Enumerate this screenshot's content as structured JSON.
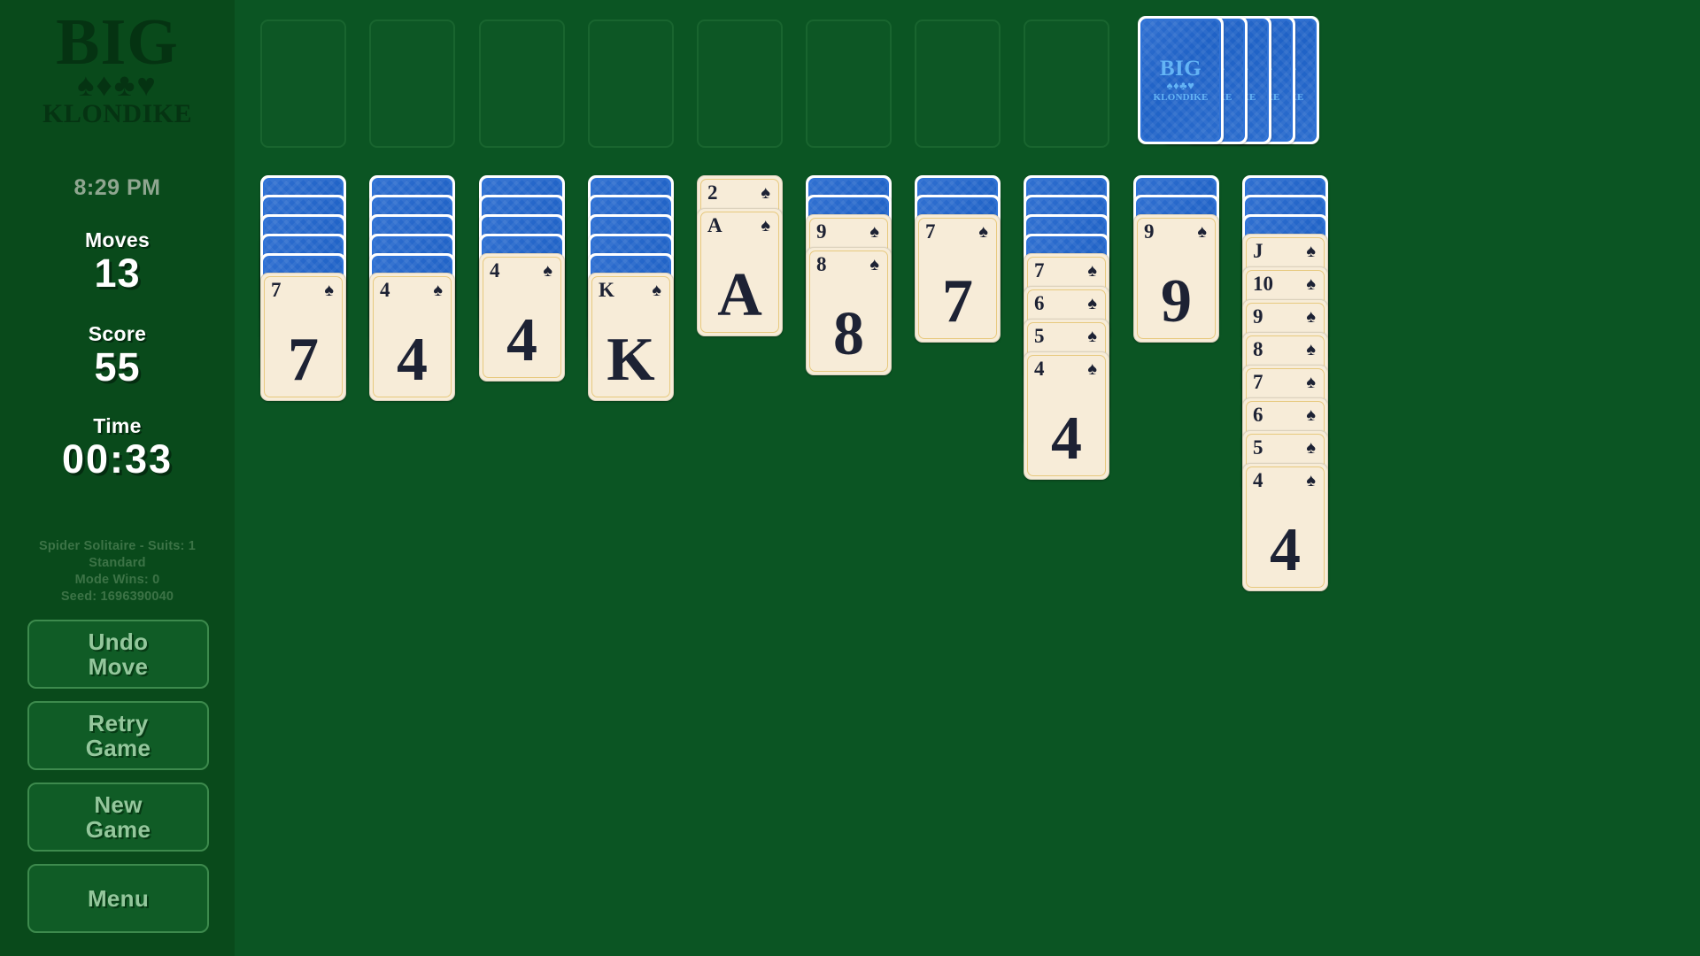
{
  "app": {
    "logo_top": "BIG",
    "logo_suits": "♠♦♣♥",
    "logo_bottom": "KLONDIKE",
    "clock": "8:29 PM",
    "table_color": "#0b5523",
    "sidebar_color": "#094a1b",
    "card_back_color": "#2464c8",
    "card_face_color": "#f7ecd8"
  },
  "stats": {
    "moves_label": "Moves",
    "moves_value": "13",
    "score_label": "Score",
    "score_value": "55",
    "time_label": "Time",
    "time_value": "00:33"
  },
  "game_info": {
    "line1": "Spider Solitaire - Suits: 1",
    "line2": "Standard",
    "line3": "Mode Wins: 0",
    "line4": "Seed: 1696390040"
  },
  "buttons": [
    {
      "name": "undo-move-button",
      "label": "Undo\nMove"
    },
    {
      "name": "retry-game-button",
      "label": "Retry\nGame"
    },
    {
      "name": "new-game-button",
      "label": "New\nGame"
    },
    {
      "name": "menu-button",
      "label": "Menu"
    }
  ],
  "board": {
    "foundation_count": 8,
    "foundations": [
      {
        "index": 1,
        "empty": true
      },
      {
        "index": 2,
        "empty": true
      },
      {
        "index": 3,
        "empty": true
      },
      {
        "index": 4,
        "empty": true
      },
      {
        "index": 5,
        "empty": true
      },
      {
        "index": 6,
        "empty": true
      },
      {
        "index": 7,
        "empty": true
      },
      {
        "index": 8,
        "empty": true
      }
    ],
    "stock": {
      "deal_piles_remaining": 5,
      "label": "stock-pile"
    },
    "card_back_text": {
      "top": "BIG",
      "suits": "♠♦♣♥",
      "bottom": "KLONDIKE"
    },
    "tableau": [
      {
        "column": 1,
        "facedown": 5,
        "faceup": [
          {
            "rank": "7",
            "suit": "♠"
          }
        ]
      },
      {
        "column": 2,
        "facedown": 5,
        "faceup": [
          {
            "rank": "4",
            "suit": "♠"
          }
        ]
      },
      {
        "column": 3,
        "facedown": 4,
        "faceup": [
          {
            "rank": "4",
            "suit": "♠"
          }
        ]
      },
      {
        "column": 4,
        "facedown": 5,
        "faceup": [
          {
            "rank": "K",
            "suit": "♠"
          }
        ]
      },
      {
        "column": 5,
        "facedown": 0,
        "faceup": [
          {
            "rank": "2",
            "suit": "♠"
          },
          {
            "rank": "A",
            "suit": "♠"
          }
        ]
      },
      {
        "column": 6,
        "facedown": 2,
        "faceup": [
          {
            "rank": "9",
            "suit": "♠"
          },
          {
            "rank": "8",
            "suit": "♠"
          }
        ]
      },
      {
        "column": 7,
        "facedown": 2,
        "faceup": [
          {
            "rank": "7",
            "suit": "♠"
          }
        ]
      },
      {
        "column": 8,
        "facedown": 4,
        "faceup": [
          {
            "rank": "7",
            "suit": "♠"
          },
          {
            "rank": "6",
            "suit": "♠"
          },
          {
            "rank": "5",
            "suit": "♠"
          },
          {
            "rank": "4",
            "suit": "♠"
          }
        ]
      },
      {
        "column": 9,
        "facedown": 2,
        "faceup": [
          {
            "rank": "9",
            "suit": "♠"
          }
        ]
      },
      {
        "column": 10,
        "facedown": 3,
        "faceup": [
          {
            "rank": "J",
            "suit": "♠"
          },
          {
            "rank": "10",
            "suit": "♠"
          },
          {
            "rank": "9",
            "suit": "♠"
          },
          {
            "rank": "8",
            "suit": "♠"
          },
          {
            "rank": "7",
            "suit": "♠"
          },
          {
            "rank": "6",
            "suit": "♠"
          },
          {
            "rank": "5",
            "suit": "♠"
          },
          {
            "rank": "4",
            "suit": "♠"
          }
        ]
      }
    ]
  }
}
